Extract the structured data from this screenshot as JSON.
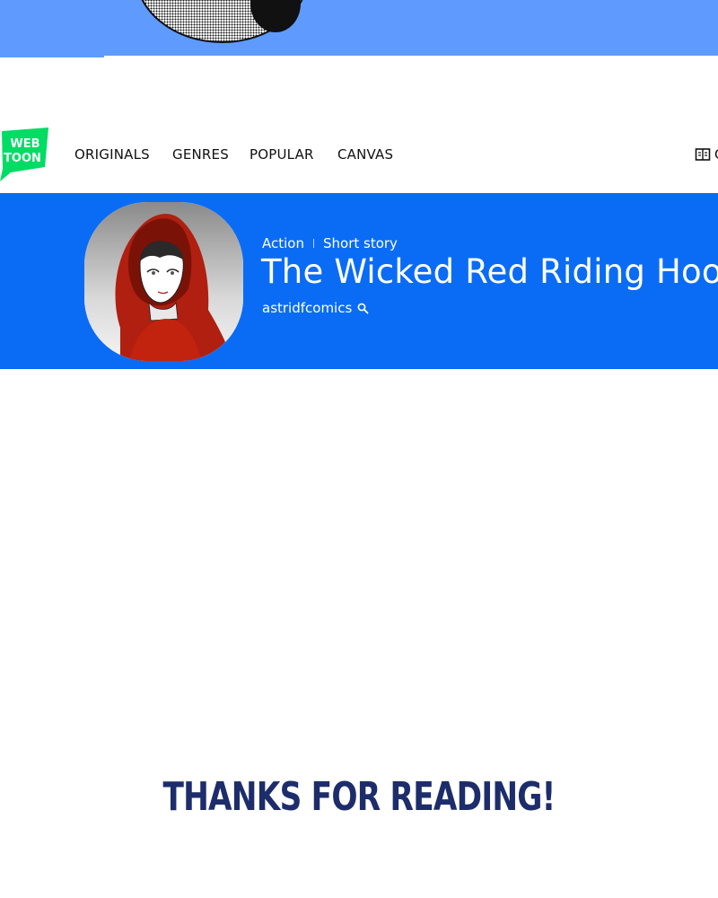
{
  "nav": {
    "items": [
      {
        "label": "ORIGINALS"
      },
      {
        "label": "GENRES"
      },
      {
        "label": "POPULAR"
      },
      {
        "label": "CANVAS"
      }
    ],
    "right_partial": "C"
  },
  "logo": {
    "line1": "WEB",
    "line2": "TOON",
    "color": "#00dc64"
  },
  "series": {
    "genre": "Action",
    "subgenre": "Short story",
    "title": "The Wicked Red Riding Hood",
    "author": "astridfcomics"
  },
  "colors": {
    "banner": "#0a6cf5",
    "top_strip": "#5f9bff",
    "thanks_text": "#1d2d6b"
  },
  "footer": {
    "thanks": "THANKS FOR READING!"
  }
}
